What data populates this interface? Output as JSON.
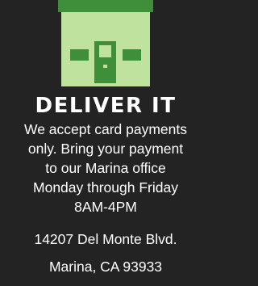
{
  "colors": {
    "background": "#232323",
    "accent_green": "#3e8e3a",
    "light_green": "#bfe29f",
    "text": "#ffffff"
  },
  "icon": "storefront-icon",
  "heading": "DELIVER IT",
  "body": {
    "line1": "We accept card payments",
    "line2": "only. Bring your payment",
    "line3": "to our Marina office",
    "line4": "Monday through Friday",
    "line5": "8AM-4PM"
  },
  "address": {
    "street": "14207 Del Monte Blvd.",
    "city": "Marina, CA 93933"
  }
}
